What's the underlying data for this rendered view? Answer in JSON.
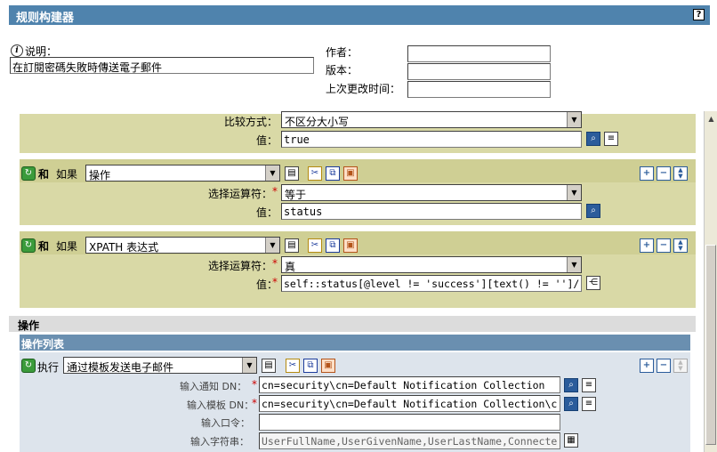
{
  "window": {
    "title": "规则构建器",
    "help": "?"
  },
  "meta": {
    "description_label": "说明：",
    "description_value": "在訂閱密碼失敗時傳送電子郵件",
    "author_label": "作者：",
    "author_value": "",
    "version_label": "版本：",
    "version_value": "",
    "last_modified_label": "上次更改时间："
  },
  "rule": {
    "row1": {
      "compare_label": "比较方式：",
      "compare_value": "不区分大小写",
      "value_label": "值：",
      "value": "true"
    },
    "row2": {
      "and_label": "和",
      "if_label": "如果",
      "condition": "操作",
      "operator_label": "选择运算符：",
      "operator_value": "等于",
      "value_label": "值：",
      "value": "status"
    },
    "row3": {
      "and_label": "和",
      "if_label": "如果",
      "condition": "XPATH 表达式",
      "operator_label": "选择运算符：",
      "operator_value": "真",
      "value_label": "值：",
      "value": "self::status[@level != 'success'][text() != '']/"
    }
  },
  "actions": {
    "header": "操作",
    "list_header": "操作列表",
    "do_label": "执行",
    "action": "通过模板发送电子邮件",
    "fields": {
      "notify_dn_label": "输入通知 DN：",
      "notify_dn_value": "cn=security\\cn=Default Notification Collection",
      "template_dn_label": "输入模板 DN：",
      "template_dn_value": "cn=security\\cn=Default Notification Collection\\c",
      "password_label": "输入口令：",
      "password_value": "",
      "string_label": "输入字符串：",
      "string_value": "UserFullName,UserGivenName,UserLastName,Connecte"
    }
  },
  "icons": {
    "help": "help-icon",
    "search": "search-icon",
    "edit": "edit-list-icon",
    "refresh": "refresh-icon",
    "cut": "scissors-icon",
    "copy": "copy-icon",
    "paste": "paste-icon",
    "add": "plus-icon",
    "remove": "minus-icon",
    "move": "up-down-icon",
    "tree": "xpath-builder-icon",
    "info": "info-icon"
  },
  "colors": {
    "titlebar": "#4f83ad",
    "rule_panel": "#d9d9a6",
    "action_header": "#6a8fb0",
    "required": "#cc0000"
  }
}
